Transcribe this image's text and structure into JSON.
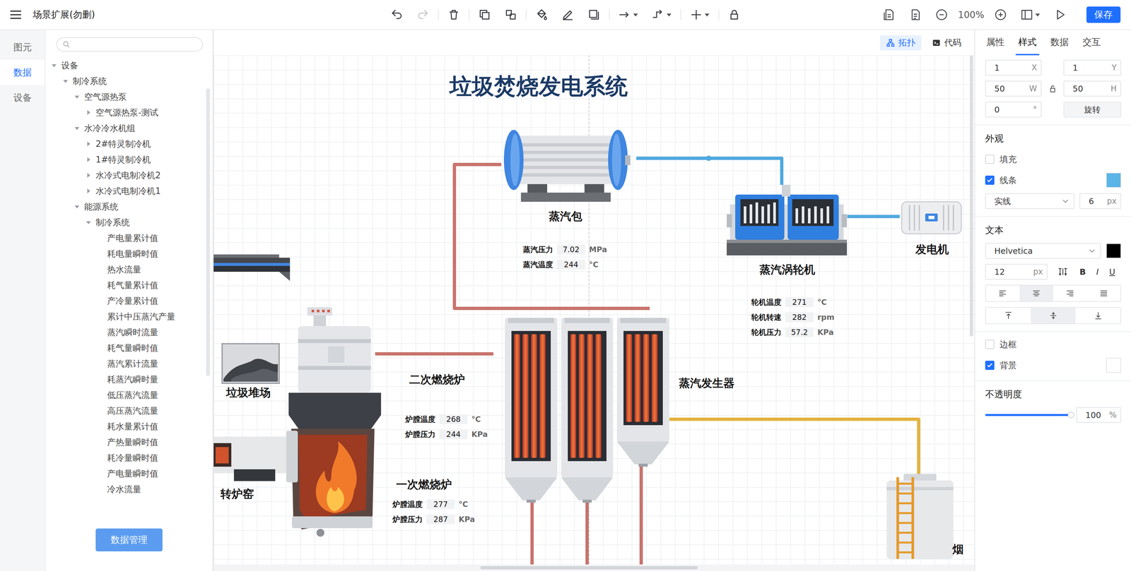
{
  "window": {
    "title": "场景扩展(勿删)"
  },
  "toolbar": {
    "groups": [
      [
        {
          "disabled": false,
          "menu": false
        },
        {
          "disabled": true,
          "menu": false
        }
      ],
      [
        {
          "disabled": false,
          "menu": false
        }
      ],
      [
        {
          "disabled": false,
          "menu": false
        },
        {
          "disabled": false,
          "menu": false
        }
      ],
      [
        {
          "disabled": false,
          "menu": false
        },
        {
          "disabled": false,
          "menu": false
        },
        {
          "disabled": false,
          "menu": false
        }
      ],
      [
        {
          "disabled": false,
          "menu": true
        },
        {
          "disabled": false,
          "menu": true
        }
      ],
      [
        {
          "disabled": false,
          "menu": true
        }
      ],
      [
        {
          "disabled": false,
          "menu": false
        }
      ]
    ]
  },
  "view_controls": {
    "zoom": "100%",
    "tools": [
      {
        "menu": false
      },
      {
        "menu": false
      },
      {
        "menu": false
      },
      {
        "menu": false
      },
      {
        "menu": true
      },
      {
        "menu": false
      }
    ]
  },
  "save_button": "保存",
  "rail_tabs": [
    {
      "label": "图元",
      "selected": false
    },
    {
      "label": "数据",
      "selected": true
    },
    {
      "label": "设备",
      "selected": false
    }
  ],
  "search": {
    "placeholder": ""
  },
  "tree": [
    {
      "label": "设备",
      "depth": 0,
      "has_children": true,
      "expanded": true
    },
    {
      "label": "制冷系统",
      "depth": 1,
      "has_children": true,
      "expanded": true
    },
    {
      "label": "空气源热泵",
      "depth": 2,
      "has_children": true,
      "expanded": true
    },
    {
      "label": "空气源热泵-测试",
      "depth": 3,
      "has_children": true,
      "expanded": false
    },
    {
      "label": "水冷冷水机组",
      "depth": 2,
      "has_children": true,
      "expanded": true
    },
    {
      "label": "2#特灵制冷机",
      "depth": 3,
      "has_children": true,
      "expanded": false
    },
    {
      "label": "1#特灵制冷机",
      "depth": 3,
      "has_children": true,
      "expanded": false
    },
    {
      "label": "水冷式电制冷机2",
      "depth": 3,
      "has_children": true,
      "expanded": false
    },
    {
      "label": "水冷式电制冷机1",
      "depth": 3,
      "has_children": true,
      "expanded": false
    },
    {
      "label": "能源系统",
      "depth": 2,
      "has_children": true,
      "expanded": true
    },
    {
      "label": "制冷系统",
      "depth": 3,
      "has_children": true,
      "expanded": true
    },
    {
      "label": "产电量累计值",
      "depth": 4,
      "has_children": false,
      "expanded": false
    },
    {
      "label": "耗电量瞬时值",
      "depth": 4,
      "has_children": false,
      "expanded": false
    },
    {
      "label": "热水流量",
      "depth": 4,
      "has_children": false,
      "expanded": false
    },
    {
      "label": "耗气量累计值",
      "depth": 4,
      "has_children": false,
      "expanded": false
    },
    {
      "label": "产冷量累计值",
      "depth": 4,
      "has_children": false,
      "expanded": false
    },
    {
      "label": "累计中压蒸汽产量",
      "depth": 4,
      "has_children": false,
      "expanded": false
    },
    {
      "label": "蒸汽瞬时流量",
      "depth": 4,
      "has_children": false,
      "expanded": false
    },
    {
      "label": "耗气量瞬时值",
      "depth": 4,
      "has_children": false,
      "expanded": false
    },
    {
      "label": "蒸汽累计流量",
      "depth": 4,
      "has_children": false,
      "expanded": false
    },
    {
      "label": "耗蒸汽瞬时量",
      "depth": 4,
      "has_children": false,
      "expanded": false
    },
    {
      "label": "低压蒸汽流量",
      "depth": 4,
      "has_children": false,
      "expanded": false
    },
    {
      "label": "高压蒸汽流量",
      "depth": 4,
      "has_children": false,
      "expanded": false
    },
    {
      "label": "耗水量累计值",
      "depth": 4,
      "has_children": false,
      "expanded": false
    },
    {
      "label": "产热量瞬时值",
      "depth": 4,
      "has_children": false,
      "expanded": false
    },
    {
      "label": "耗冷量瞬时值",
      "depth": 4,
      "has_children": false,
      "expanded": false
    },
    {
      "label": "产电量瞬时值",
      "depth": 4,
      "has_children": false,
      "expanded": false
    },
    {
      "label": "冷水流量",
      "depth": 4,
      "has_children": false,
      "expanded": false
    }
  ],
  "data_button": "数据管理",
  "canvas": {
    "buttons": [
      {
        "label": "拓扑",
        "selected": true
      },
      {
        "label": "代码",
        "selected": false
      }
    ],
    "title": "垃圾焚烧发电系统",
    "pipes": [
      {
        "color": "#c8736c"
      },
      {
        "color": "#4fa9df"
      },
      {
        "color": "#4fa9df"
      },
      {
        "color": "#c8736c"
      },
      {
        "color": "#e2b33e"
      },
      {
        "color": "#c8736c"
      },
      {
        "color": "#c8736c"
      },
      {
        "color": "#c8736c"
      }
    ],
    "nodes": [
      {
        "kind": "steam-drum",
        "label": "蒸汽包",
        "readings": [
          {
            "label": "蒸汽压力",
            "value": "7.02",
            "unit": "MPa"
          },
          {
            "label": "蒸汽温度",
            "value": "244",
            "unit": "°C"
          }
        ]
      },
      {
        "kind": "turbine",
        "label": "蒸汽涡轮机",
        "readings": [
          {
            "label": "轮机温度",
            "value": "271",
            "unit": "°C"
          },
          {
            "label": "轮机转速",
            "value": "282",
            "unit": "rpm"
          },
          {
            "label": "轮机压力",
            "value": "57.2",
            "unit": "KPa"
          }
        ]
      },
      {
        "kind": "generator",
        "label": "发电机",
        "readings": []
      },
      {
        "kind": "steam-generator",
        "label": "蒸汽发生器",
        "readings": []
      },
      {
        "kind": "secondary-furnace",
        "label": "二次燃烧炉",
        "readings": [
          {
            "label": "炉膛温度",
            "value": "268",
            "unit": "°C"
          },
          {
            "label": "炉膛压力",
            "value": "244",
            "unit": "KPa"
          }
        ]
      },
      {
        "kind": "primary-furnace",
        "label": "一次燃烧炉",
        "readings": [
          {
            "label": "炉膛温度",
            "value": "277",
            "unit": "°C"
          },
          {
            "label": "炉膛压力",
            "value": "287",
            "unit": "KPa"
          }
        ]
      },
      {
        "kind": "incinerator",
        "readings": []
      },
      {
        "kind": "garbage-yard",
        "label": "垃圾堆场",
        "readings": []
      },
      {
        "kind": "rotary-kiln",
        "label": "转炉窑",
        "readings": []
      },
      {
        "kind": "conveyor",
        "readings": []
      },
      {
        "kind": "chimney-tank",
        "label": "烟",
        "readings": []
      }
    ]
  },
  "properties": {
    "tabs": [
      {
        "label": "属性",
        "selected": false
      },
      {
        "label": "样式",
        "selected": true
      },
      {
        "label": "数据",
        "selected": false
      },
      {
        "label": "交互",
        "selected": false
      }
    ],
    "position": [
      {
        "value": "1",
        "unit": "X"
      },
      {
        "value": "1",
        "unit": "Y"
      }
    ],
    "size": [
      {
        "value": "50",
        "unit": "W"
      },
      {
        "value": "50",
        "unit": "H"
      }
    ],
    "rotation": {
      "value": "0",
      "unit": "°"
    },
    "rotate_button": "旋转",
    "appearance": {
      "title": "外观",
      "fill": {
        "label": "填充",
        "checked": false
      },
      "stroke": {
        "label": "线条",
        "checked": true,
        "color": "#5ab4e5"
      },
      "line_style": "实线",
      "line_width": "6",
      "line_unit": "px"
    },
    "text": {
      "title": "文本",
      "font": "Helvetica",
      "color": "#000000",
      "size": "12",
      "size_unit": "px",
      "styles": [
        "B",
        "I",
        "U"
      ],
      "align": [
        {
          "selected": false
        },
        {
          "selected": true
        },
        {
          "selected": false
        },
        {
          "selected": false
        }
      ],
      "valign": [
        {
          "selected": false
        },
        {
          "selected": true
        },
        {
          "selected": false
        }
      ]
    },
    "border": {
      "label": "边框",
      "checked": false
    },
    "background": {
      "label": "背景",
      "checked": true,
      "color": "#ffffff"
    },
    "opacity": {
      "title": "不透明度",
      "level": 1,
      "value": "100",
      "unit": "%"
    }
  }
}
